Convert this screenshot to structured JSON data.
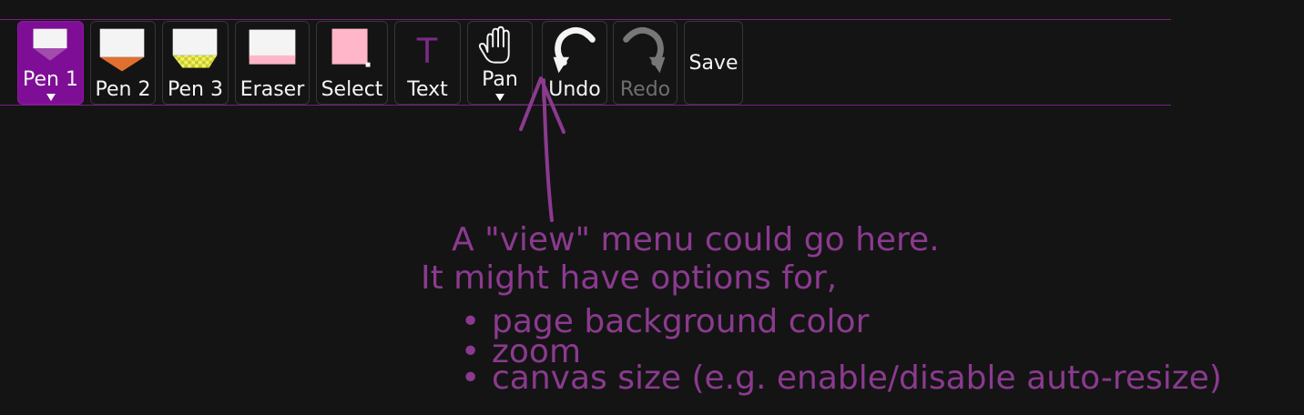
{
  "toolbar": {
    "tools": [
      {
        "id": "pen1",
        "label": "Pen 1",
        "has_menu": true,
        "active": true,
        "color": "#9c3fa6"
      },
      {
        "id": "pen2",
        "label": "Pen 2",
        "has_menu": false,
        "active": false,
        "color": "#e07030"
      },
      {
        "id": "pen3",
        "label": "Pen 3",
        "has_menu": false,
        "active": false,
        "color": "#d9dd3a"
      },
      {
        "id": "eraser",
        "label": "Eraser",
        "has_menu": false,
        "active": false,
        "color": "#ffb6c8"
      },
      {
        "id": "select",
        "label": "Select",
        "has_menu": false,
        "active": false,
        "color": "#ffb6c8"
      },
      {
        "id": "text",
        "label": "Text",
        "icon_glyph": "T",
        "has_menu": false,
        "active": false
      },
      {
        "id": "pan",
        "label": "Pan",
        "has_menu": true,
        "active": false
      },
      {
        "id": "undo",
        "label": "Undo",
        "enabled": true
      },
      {
        "id": "redo",
        "label": "Redo",
        "enabled": false
      },
      {
        "id": "save",
        "label": "Save"
      }
    ],
    "accent_color": "#7f0e96",
    "divider_color": "#7a1f83"
  },
  "annotation": {
    "color": "#8b3a8f",
    "line1": "A \"view\" menu could go here.",
    "line2": "It might have options for,",
    "bullet_mark": "•",
    "bullets": [
      "page background color",
      "zoom",
      "canvas size (e.g. enable/disable auto-resize)"
    ]
  }
}
